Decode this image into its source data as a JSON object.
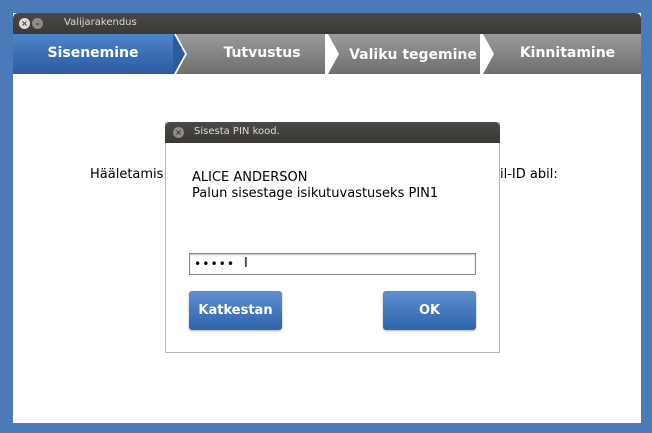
{
  "window": {
    "title": "Valijarakendus",
    "close_glyph": "×",
    "minimize_glyph": "–"
  },
  "steps": [
    {
      "label": "Sisenemine",
      "active": true
    },
    {
      "label": "Tutvustus",
      "active": false
    },
    {
      "label": "Valiku tegemine",
      "active": false
    },
    {
      "label": "Kinnitamine",
      "active": false
    }
  ],
  "main": {
    "text_left": "Hääletamis",
    "text_right": "il-ID abil:"
  },
  "dialog": {
    "title": "Sisesta PIN kood.",
    "close_glyph": "×",
    "name": "ALICE ANDERSON",
    "prompt": "Palun sisestage isikutuvastuseks PIN1",
    "pin_value": "•••••",
    "cursor_glyph": "I",
    "cancel_label": "Katkestan",
    "ok_label": "OK"
  },
  "colors": {
    "accent": "#2e62aa",
    "titlebar": "#3a3935",
    "desktop": "#4b7ab8"
  }
}
